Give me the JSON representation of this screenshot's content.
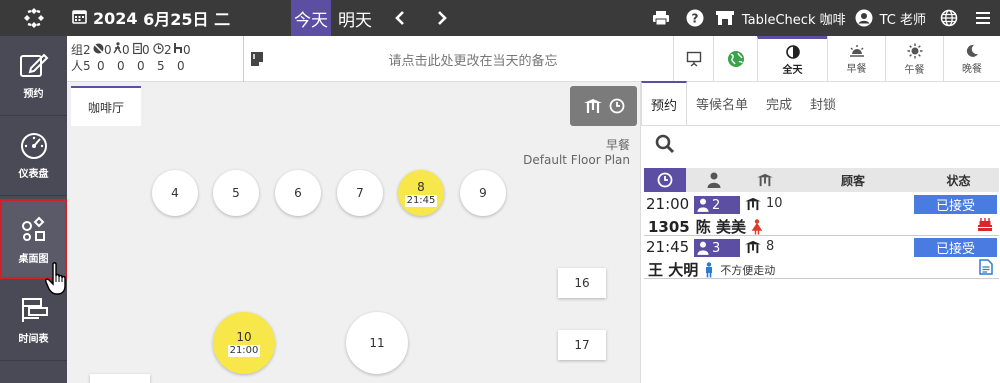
{
  "topbar": {
    "year": "2024",
    "date": "6月25日 二",
    "today": "今天",
    "tomorrow": "明天",
    "prev_glyph": "‹",
    "next_glyph": "›",
    "venue": "TableCheck 咖啡",
    "user": "TC 老师"
  },
  "sidebar": {
    "items": [
      {
        "label": "预约",
        "icon": "pencil-square-icon"
      },
      {
        "label": "仪表盘",
        "icon": "gauge-icon"
      },
      {
        "label": "桌面图",
        "icon": "floor-plan-icon"
      },
      {
        "label": "时间表",
        "icon": "timetable-icon"
      }
    ],
    "active_index": 2
  },
  "summary": {
    "row1_label": "组",
    "row1": [
      "2",
      "0",
      "0",
      "0",
      "2",
      "0"
    ],
    "row2_label": "人",
    "row2": [
      "5",
      "0",
      "0",
      "0",
      "5",
      "0"
    ],
    "memo_placeholder": "请点击此处更改在当天的备忘",
    "meal_filters": [
      {
        "label": "全天",
        "icon": "half-circle-icon",
        "active": true
      },
      {
        "label": "早餐",
        "icon": "sunrise-icon",
        "active": false
      },
      {
        "label": "午餐",
        "icon": "sun-icon",
        "active": false
      },
      {
        "label": "晚餐",
        "icon": "moon-icon",
        "active": false
      }
    ]
  },
  "floor": {
    "room_tab": "咖啡厅",
    "plan_service": "早餐",
    "plan_name": "Default Floor Plan",
    "tables": [
      {
        "no": "4",
        "time": ""
      },
      {
        "no": "5",
        "time": ""
      },
      {
        "no": "6",
        "time": ""
      },
      {
        "no": "7",
        "time": ""
      },
      {
        "no": "8",
        "time": "21:45"
      },
      {
        "no": "9",
        "time": ""
      },
      {
        "no": "10",
        "time": "21:00"
      },
      {
        "no": "11",
        "time": ""
      },
      {
        "no": "16",
        "time": ""
      },
      {
        "no": "17",
        "time": ""
      }
    ]
  },
  "panel": {
    "tabs": [
      "预约",
      "等候名单",
      "完成",
      "封锁"
    ],
    "active_tab": 0,
    "columns": {
      "guest": "顾客",
      "status": "状态"
    },
    "reservations": [
      {
        "time": "21:00",
        "party": "2",
        "table": "10",
        "code": "1305",
        "name": "陈 美美",
        "note": "",
        "status": "已接受"
      },
      {
        "time": "21:45",
        "party": "3",
        "table": "8",
        "code": "",
        "name": "王 大明",
        "note": "不方便走动",
        "status": "已接受"
      }
    ]
  },
  "colors": {
    "accent": "#5b4ea3",
    "topbar": "#3a3a3a",
    "sidebar": "#4a4a56",
    "status_blue": "#4a7be0",
    "table_busy": "#f7e74a"
  }
}
